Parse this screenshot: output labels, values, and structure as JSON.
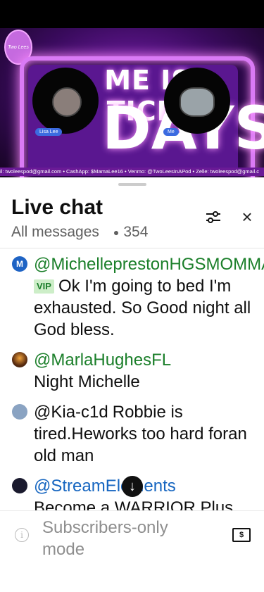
{
  "stream": {
    "logo_text": "Two Lees",
    "banner_line1": "ME IS TICKI",
    "banner_line2": "DAYS",
    "left_name": "Lisa Lee",
    "right_name": "Me",
    "ticker": "il: twoleespod@gmail.com • CashApp: $MamaLee16 • Venmo: @TwoLeesInAPod • Zelle: twoleespod@gmail.c"
  },
  "chat": {
    "title": "Live chat",
    "filter_label": "All messages",
    "viewer_count": "354",
    "messages": [
      {
        "avatar": "M",
        "avatar_color": "#1e63c4",
        "author": "@MichelleprestonHGSMOMMA",
        "author_color": "green",
        "badge": "VIP",
        "text": "Ok I'm going to bed I'm exhausted. So Good night all God bless."
      },
      {
        "avatar": "",
        "avatar_color": "#5a2c10",
        "author": "@MarlaHughesFL",
        "author_color": "green",
        "badge": "",
        "text": "Night Michelle"
      },
      {
        "avatar": "",
        "avatar_color": "#8aa3c2",
        "author": "@Kia-c1d",
        "author_color": "plain",
        "badge": "",
        "text": "Robbie is tired.Heworks too hard foran old man"
      },
      {
        "avatar": "",
        "avatar_color": "#1a1a2e",
        "author": "@StreamElements",
        "author_color": "blue",
        "badge": "",
        "text": "Become a WARRIOR Plus"
      }
    ],
    "footer_text": "Subscribers-only mode",
    "icons": {
      "info": "info-icon",
      "money": "super-chat-icon",
      "tune": "tune-icon",
      "close": "close-icon",
      "scroll": "arrow-down-icon"
    }
  }
}
